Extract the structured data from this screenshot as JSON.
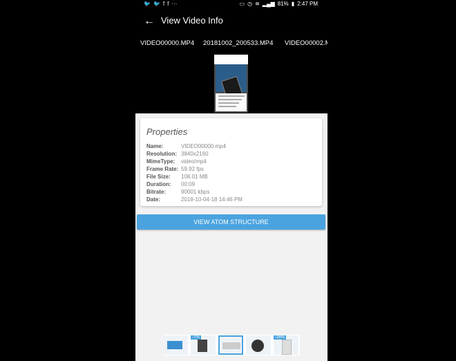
{
  "statusbar": {
    "left_icons": [
      "twitter-icon",
      "twitter-icon",
      "facebook-icon",
      "facebook-icon",
      "more-icon"
    ],
    "left_glyphs": [
      "🐦",
      "🐦",
      "f",
      "f",
      "···"
    ],
    "battery": "81%",
    "time": "2:47 PM"
  },
  "appbar": {
    "title": "View Video Info",
    "back_glyph": "←"
  },
  "tabs": [
    {
      "label": "VIDEO00000.MP4"
    },
    {
      "label": "20181002_200533.MP4"
    },
    {
      "label": "VIDEO00002.M"
    }
  ],
  "properties": {
    "title": "Properties",
    "rows": [
      {
        "key": "Name:",
        "value": "VIDEO00000.mp4"
      },
      {
        "key": "Resolution:",
        "value": "3840x2160"
      },
      {
        "key": "MimeType:",
        "value": "video/mp4"
      },
      {
        "key": "Frame Rate:",
        "value": "59.92 fps"
      },
      {
        "key": "File Size:",
        "value": "108.01 MB"
      },
      {
        "key": "Duration:",
        "value": "00:09"
      },
      {
        "key": "Bitrate:",
        "value": "90001 kbps"
      },
      {
        "key": "Date:",
        "value": "2018-10-04-18 14:46 PM"
      }
    ]
  },
  "button": {
    "label": "VIEW ATOM STRUCTURE"
  },
  "ads": {
    "badges": [
      "-7%",
      "-26%"
    ]
  },
  "colors": {
    "accent": "#4aa3df",
    "background": "#f2f2f2"
  }
}
